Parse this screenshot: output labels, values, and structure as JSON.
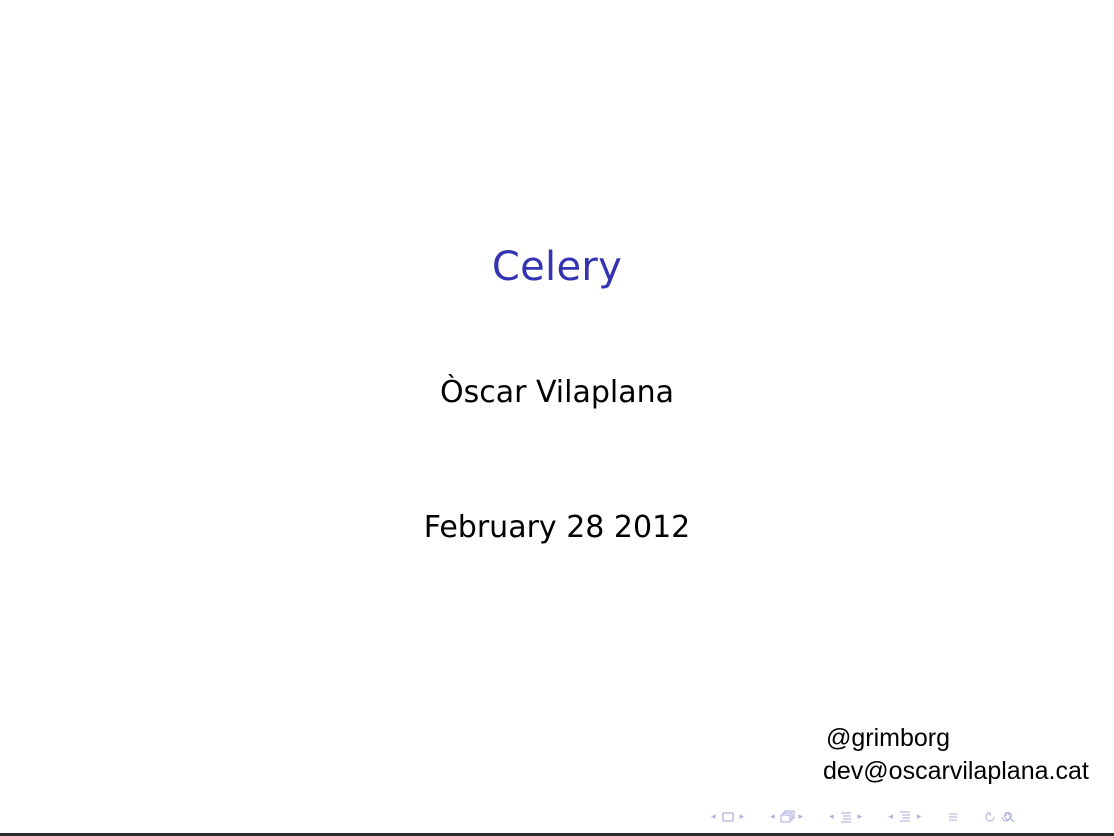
{
  "slide": {
    "title": "Celery",
    "author": "Òscar Vilaplana",
    "date": "February 28 2012",
    "contact": {
      "handle": "@grimborg",
      "email": "dev@oscarvilaplana.cat"
    }
  },
  "navigation": {
    "left_arrow": "◂",
    "right_arrow": "▸",
    "groups": [
      "frame",
      "subsection",
      "section",
      "subsubsection"
    ],
    "appendix_icon": "align-icon",
    "search_icons": [
      "back-forward-icon",
      "search-icon"
    ]
  },
  "colors": {
    "title": "#3333b3",
    "nav": "#b0b0e0",
    "text": "#000000"
  }
}
